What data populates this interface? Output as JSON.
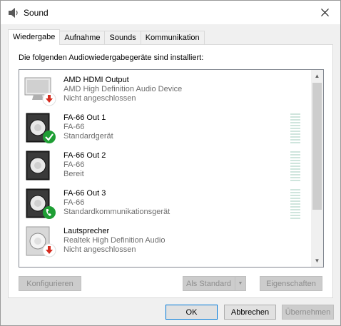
{
  "window": {
    "title": "Sound",
    "icon": "speaker-icon",
    "close_icon": "close-icon"
  },
  "tabs": [
    {
      "label": "Wiedergabe",
      "active": true
    },
    {
      "label": "Aufnahme",
      "active": false
    },
    {
      "label": "Sounds",
      "active": false
    },
    {
      "label": "Kommunikation",
      "active": false
    }
  ],
  "intro_text": "Die folgenden Audiowiedergabegeräte sind installiert:",
  "devices": [
    {
      "name": "AMD HDMI Output",
      "driver": "AMD High Definition Audio Device",
      "status": "Nicht angeschlossen",
      "icon": "monitor-icon",
      "badge": "disconnected-arrow-icon"
    },
    {
      "name": "FA-66 Out 1",
      "driver": "FA-66",
      "status": "Standardgerät",
      "icon": "speaker-box-icon",
      "badge": "default-check-icon"
    },
    {
      "name": "FA-66 Out 2",
      "driver": "FA-66",
      "status": "Bereit",
      "icon": "speaker-box-icon",
      "badge": ""
    },
    {
      "name": "FA-66 Out 3",
      "driver": "FA-66",
      "status": "Standardkommunikationsgerät",
      "icon": "speaker-box-icon",
      "badge": "phone-icon"
    },
    {
      "name": "Lautsprecher",
      "driver": "Realtek High Definition Audio",
      "status": "Nicht angeschlossen",
      "icon": "speaker-box-icon",
      "badge": "disconnected-arrow-icon"
    }
  ],
  "buttons": {
    "configure": "Konfigurieren",
    "set_default": "Als Standard",
    "properties": "Eigenschaften",
    "ok": "OK",
    "cancel": "Abbrechen",
    "apply": "Übernehmen"
  },
  "colors": {
    "accent": "#0078d7",
    "check_green": "#1e9e34",
    "arrow_red": "#d52b1e",
    "meter": "#cfe5dd"
  }
}
